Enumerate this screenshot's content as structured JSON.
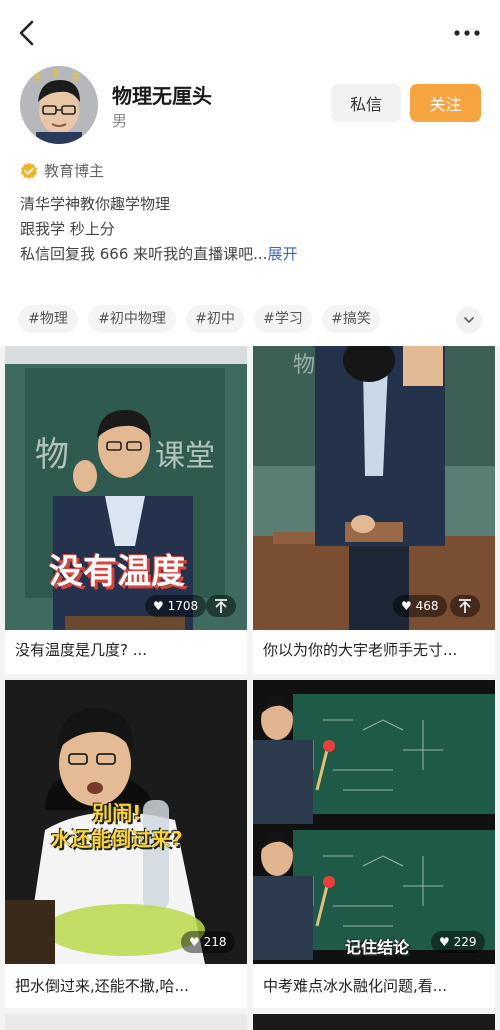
{
  "header": {
    "back_icon": "chevron-left-icon",
    "more_icon": "more-dots-icon"
  },
  "profile": {
    "name": "物理无厘头",
    "gender": "男",
    "message_label": "私信",
    "follow_label": "关注",
    "follow_color": "#f5a440",
    "verified_title": "教育博主",
    "verified_badge_color": "#f0b429"
  },
  "bio": {
    "line1": "清华学神教你趣学物理",
    "line2": "跟我学 秒上分",
    "line3": "私信回复我 666 来听我的直播课吧...",
    "expand_label": "展开"
  },
  "tags": [
    "#物理",
    "#初中物理",
    "#初中",
    "#学习",
    "#搞笑"
  ],
  "videos": [
    {
      "title": "没有温度是几度? ...",
      "likes": "1708",
      "overlay": "没有温度",
      "has_share": true
    },
    {
      "title": "你以为你的大宇老师手无寸...",
      "likes": "468",
      "overlay": "",
      "has_share": true
    },
    {
      "title": "把水倒过来,还能不撒,哈...",
      "likes": "218",
      "overlay": "别闹!\n水还能倒过来?",
      "has_share": false
    },
    {
      "title": "中考难点冰水融化问题,看...",
      "likes": "229",
      "overlay": "记住结论",
      "has_share": false
    }
  ]
}
